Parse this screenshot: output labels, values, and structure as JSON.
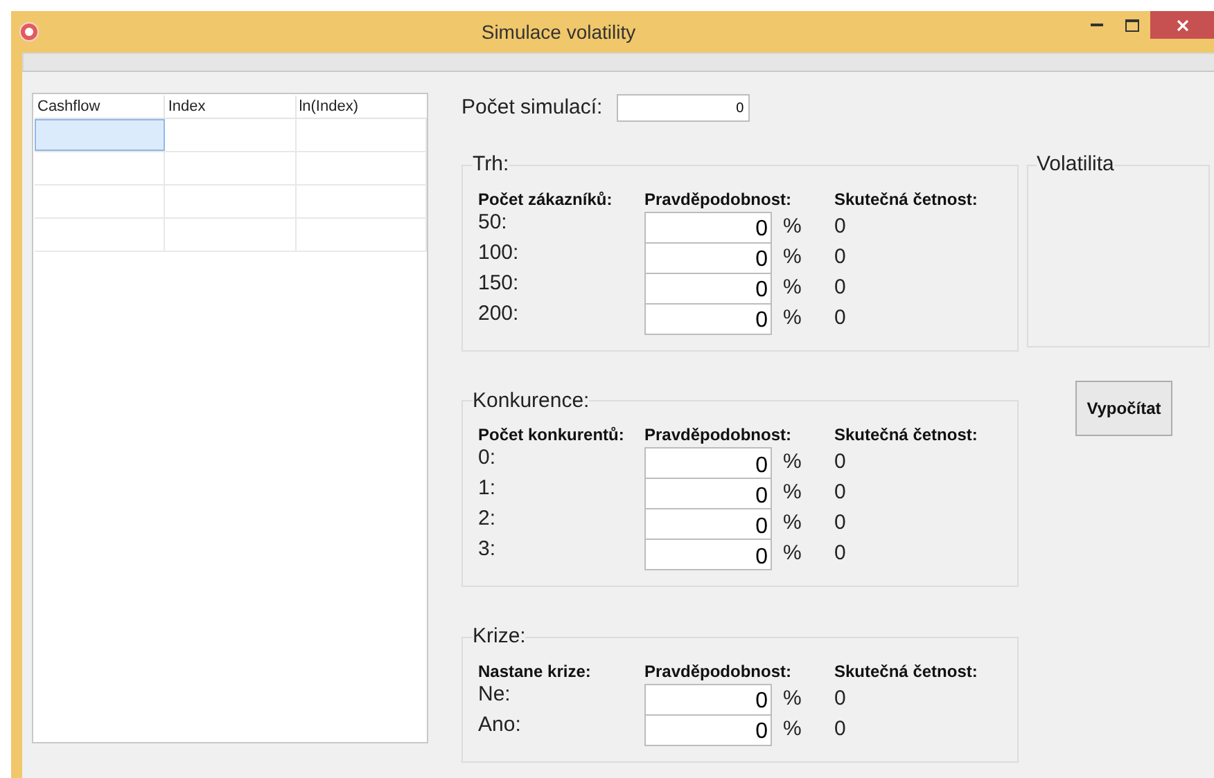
{
  "window": {
    "title": "Simulace volatility"
  },
  "table": {
    "columns": [
      "Cashflow",
      "Index",
      "ln(Index)"
    ],
    "rows": [
      {
        "cells": [
          {
            "selected": true
          },
          {
            "selected": false
          },
          {
            "selected": false
          }
        ]
      },
      {
        "cells": [
          {
            "selected": false
          },
          {
            "selected": false
          },
          {
            "selected": false
          }
        ]
      },
      {
        "cells": [
          {
            "selected": false
          },
          {
            "selected": false
          },
          {
            "selected": false
          }
        ]
      },
      {
        "cells": [
          {
            "selected": false
          },
          {
            "selected": false
          },
          {
            "selected": false
          }
        ]
      }
    ]
  },
  "simulations": {
    "label": "Počet simulací:",
    "value": "0"
  },
  "groups": [
    {
      "title": "Trh:",
      "headers": [
        "Počet zákazníků:",
        "Pravděpodobnost:",
        "Skutečná četnost:"
      ],
      "rows": [
        {
          "label": "50:",
          "probability": "0",
          "unit": "%",
          "frequency": "0"
        },
        {
          "label": "100:",
          "probability": "0",
          "unit": "%",
          "frequency": "0"
        },
        {
          "label": "150:",
          "probability": "0",
          "unit": "%",
          "frequency": "0"
        },
        {
          "label": "200:",
          "probability": "0",
          "unit": "%",
          "frequency": "0"
        }
      ]
    },
    {
      "title": "Konkurence:",
      "headers": [
        "Počet konkurentů:",
        "Pravděpodobnost:",
        "Skutečná četnost:"
      ],
      "rows": [
        {
          "label": "0:",
          "probability": "0",
          "unit": "%",
          "frequency": "0"
        },
        {
          "label": "1:",
          "probability": "0",
          "unit": "%",
          "frequency": "0"
        },
        {
          "label": "2:",
          "probability": "0",
          "unit": "%",
          "frequency": "0"
        },
        {
          "label": "3:",
          "probability": "0",
          "unit": "%",
          "frequency": "0"
        }
      ]
    },
    {
      "title": "Krize:",
      "headers": [
        "Nastane krize:",
        "Pravděpodobnost:",
        "Skutečná četnost:"
      ],
      "rows": [
        {
          "label": "Ne:",
          "probability": "0",
          "unit": "%",
          "frequency": "0"
        },
        {
          "label": "Ano:",
          "probability": "0",
          "unit": "%",
          "frequency": "0"
        }
      ]
    }
  ],
  "volatility": {
    "title": "Volatilita"
  },
  "calculate_button": "Vypočítat"
}
